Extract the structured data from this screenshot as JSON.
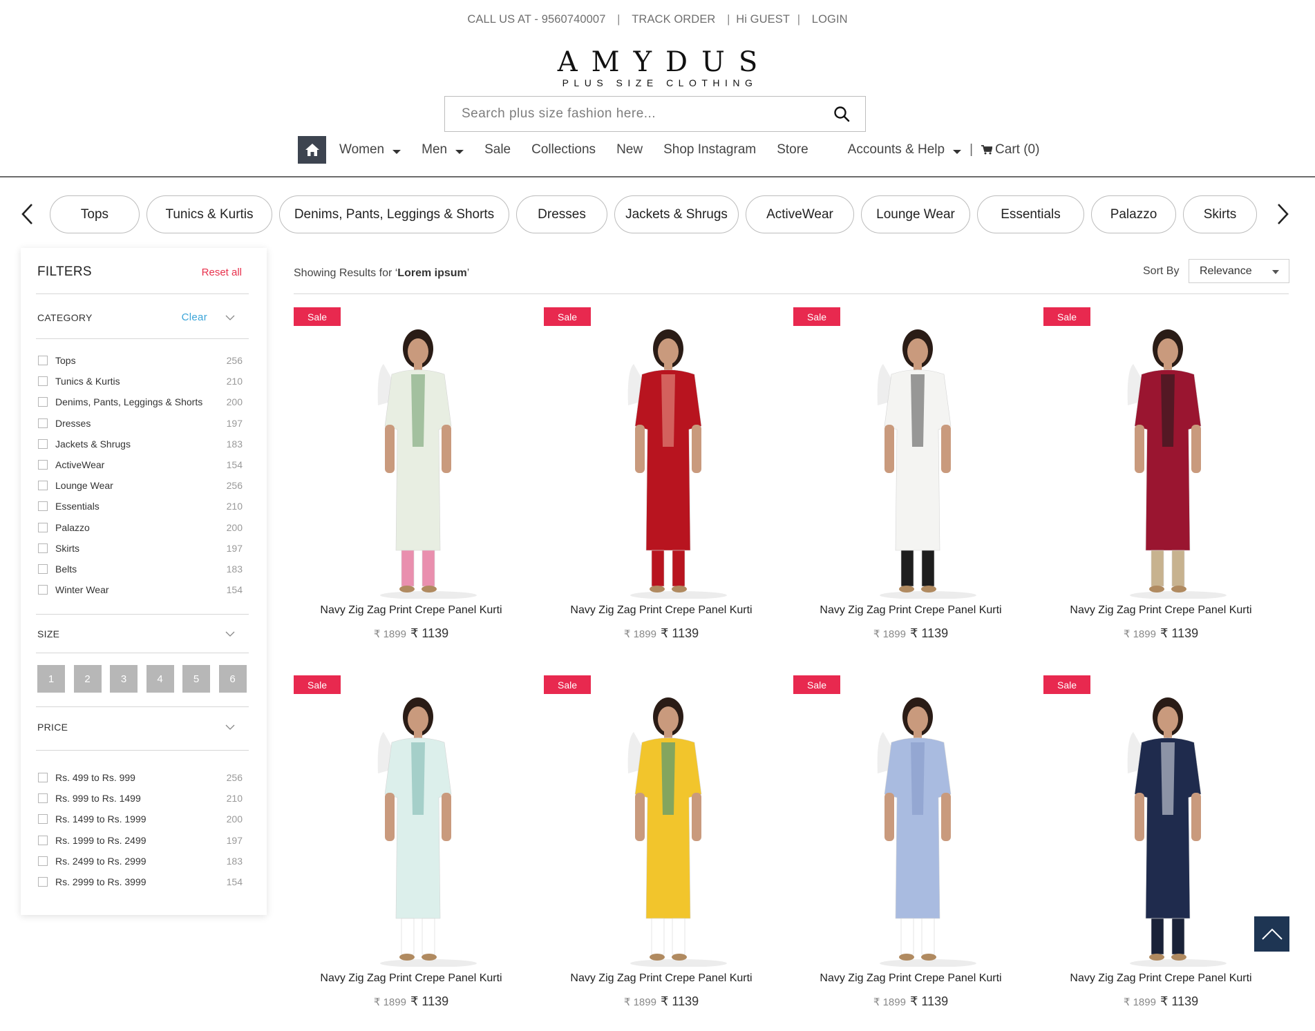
{
  "topbar": {
    "call": "CALL US AT - 9560740007",
    "track": "TRACK ORDER",
    "greet": "Hi GUEST",
    "login": "LOGIN",
    "sep": "|"
  },
  "logo": {
    "brand": "AMYDUS",
    "tagline": "PLUS SIZE CLOTHING"
  },
  "search": {
    "placeholder": "Search plus size fashion here..."
  },
  "nav": {
    "home_icon": "home-icon",
    "items": [
      "Women",
      "Men",
      "Sale",
      "Collections",
      "New",
      "Shop Instagram",
      "Store"
    ],
    "accounts": "Accounts & Help",
    "cart": "Cart (0)"
  },
  "categories": [
    "Tops",
    "Tunics & Kurtis",
    "Denims, Pants, Leggings & Shorts",
    "Dresses",
    "Jackets & Shrugs",
    "ActiveWear",
    "Lounge Wear",
    "Essentials",
    "Palazzo",
    "Skirts"
  ],
  "filters": {
    "title": "FILTERS",
    "reset": "Reset all",
    "category": {
      "title": "CATEGORY",
      "clear": "Clear",
      "items": [
        {
          "label": "Tops",
          "count": "256"
        },
        {
          "label": "Tunics & Kurtis",
          "count": "210"
        },
        {
          "label": "Denims, Pants, Leggings & Shorts",
          "count": "200"
        },
        {
          "label": "Dresses",
          "count": "197"
        },
        {
          "label": "Jackets & Shrugs",
          "count": "183"
        },
        {
          "label": "ActiveWear",
          "count": "154"
        },
        {
          "label": "Lounge Wear",
          "count": "256"
        },
        {
          "label": "Essentials",
          "count": "210"
        },
        {
          "label": "Palazzo",
          "count": "200"
        },
        {
          "label": "Skirts",
          "count": "197"
        },
        {
          "label": "Belts",
          "count": "183"
        },
        {
          "label": "Winter Wear",
          "count": "154"
        }
      ]
    },
    "size": {
      "title": "SIZE",
      "options": [
        "1",
        "2",
        "3",
        "4",
        "5",
        "6"
      ]
    },
    "price": {
      "title": "PRICE",
      "items": [
        {
          "label": "Rs. 499 to Rs. 999",
          "count": "256"
        },
        {
          "label": "Rs. 999 to Rs. 1499",
          "count": "210"
        },
        {
          "label": "Rs. 1499 to Rs. 1999",
          "count": "200"
        },
        {
          "label": "Rs. 1999 to Rs. 2499",
          "count": "197"
        },
        {
          "label": "Rs. 2499 to Rs. 2999",
          "count": "183"
        },
        {
          "label": "Rs. 2999 to Rs. 3999",
          "count": "154"
        }
      ]
    }
  },
  "results": {
    "prefix": "Showing Results for ‘",
    "query": "Lorem ipsum",
    "suffix": "’",
    "sort_label": "Sort By",
    "sort_value": "Relevance"
  },
  "products": [
    {
      "badge": "Sale",
      "name": "Navy Zig Zag Print Crepe Panel Kurti",
      "old_price": "₹ 1899",
      "price": "₹ 1139",
      "colors": {
        "top": "#e8eee2",
        "accent": "#6a9a68",
        "bottom": "#e98fae",
        "skin": "#c99a7d"
      }
    },
    {
      "badge": "Sale",
      "name": "Navy Zig Zag Print Crepe Panel Kurti",
      "old_price": "₹ 1899",
      "price": "₹ 1139",
      "colors": {
        "top": "#b8141f",
        "accent": "#e9a090",
        "bottom": "#b8141f",
        "skin": "#c99a7d"
      }
    },
    {
      "badge": "Sale",
      "name": "Navy Zig Zag Print Crepe Panel Kurti",
      "old_price": "₹ 1899",
      "price": "₹ 1139",
      "colors": {
        "top": "#f4f4f2",
        "accent": "#4a4a4a",
        "bottom": "#1e1e1e",
        "skin": "#c99a7d"
      }
    },
    {
      "badge": "Sale",
      "name": "Navy Zig Zag Print Crepe Panel Kurti",
      "old_price": "₹ 1899",
      "price": "₹ 1139",
      "colors": {
        "top": "#9a1530",
        "accent": "#1c1c1c",
        "bottom": "#c7b28f",
        "skin": "#c99a7d"
      }
    },
    {
      "badge": "Sale",
      "name": "Navy Zig Zag Print Crepe Panel Kurti",
      "old_price": "₹ 1899",
      "price": "₹ 1139",
      "colors": {
        "top": "#dcefeb",
        "accent": "#79b5ad",
        "bottom": "#ffffff",
        "skin": "#c99a7d"
      }
    },
    {
      "badge": "Sale",
      "name": "Navy Zig Zag Print Crepe Panel Kurti",
      "old_price": "₹ 1899",
      "price": "₹ 1139",
      "colors": {
        "top": "#f2c52c",
        "accent": "#2a8a88",
        "bottom": "#ffffff",
        "skin": "#c99a7d"
      }
    },
    {
      "badge": "Sale",
      "name": "Navy Zig Zag Print Crepe Panel Kurti",
      "old_price": "₹ 1899",
      "price": "₹ 1139",
      "colors": {
        "top": "#a9bbe0",
        "accent": "#8497c6",
        "bottom": "#ffffff",
        "skin": "#c99a7d"
      }
    },
    {
      "badge": "Sale",
      "name": "Navy Zig Zag Print Crepe Panel Kurti",
      "old_price": "₹ 1899",
      "price": "₹ 1139",
      "colors": {
        "top": "#1f2b4d",
        "accent": "#e6eaf0",
        "bottom": "#1a2238",
        "skin": "#c99a7d"
      }
    }
  ],
  "colors": {
    "accent_red": "#e8294f",
    "link_blue": "#3aa4d8",
    "nav_dark": "#3d4450",
    "totop_bg": "#1e3553"
  },
  "icons": {
    "search": "search-icon",
    "prev": "chevron-left-icon",
    "next": "chevron-right-icon",
    "cart": "cart-icon",
    "totop": "arrow-up-icon"
  }
}
